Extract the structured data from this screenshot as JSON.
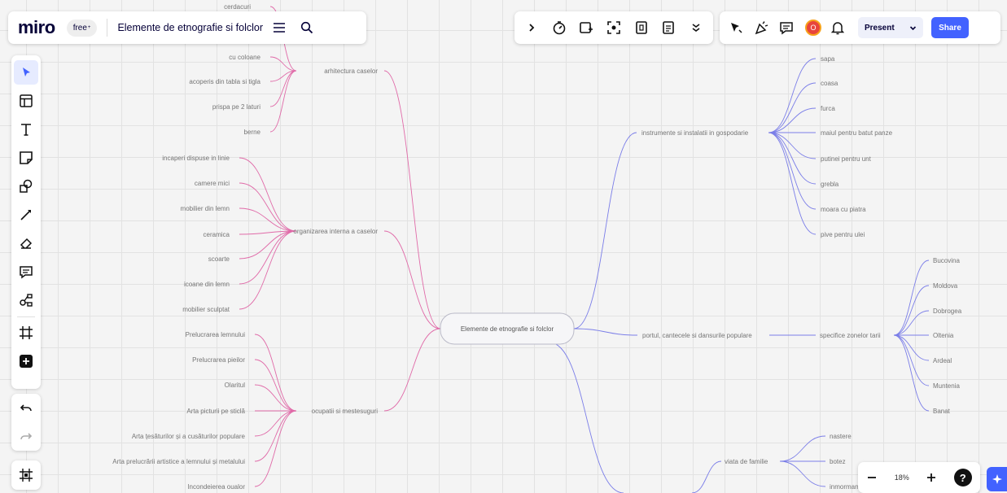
{
  "app": {
    "logo": "miro",
    "plan": "free",
    "plan_mark": "+",
    "board_title": "Elemente de etnografie si folclor"
  },
  "toolbar": {
    "present": "Present",
    "share": "Share",
    "avatar_initial": "O"
  },
  "zoom": {
    "level": "18%"
  },
  "icons": {
    "board": [
      "menu-icon",
      "search-icon"
    ],
    "top": [
      "chevron-right-icon",
      "timer-icon",
      "add-frame-icon",
      "focus-icon",
      "voting-icon",
      "notes-icon",
      "more-icon"
    ],
    "collab": [
      "reactions-icon",
      "celebrate-icon",
      "comments-icon"
    ],
    "left": [
      "select-icon",
      "templates-icon",
      "text-icon",
      "sticky-note-icon",
      "shapes-icon",
      "pen-icon",
      "eraser-icon",
      "comment-icon",
      "mindmap-icon",
      "frame-icon",
      "add-app-icon"
    ]
  },
  "colors": {
    "accent": "#4262ff",
    "branch_left": "#e06aa8",
    "branch_right": "#7b7ee8"
  },
  "mindmap": {
    "root": "Elemente de etnografie si folclor",
    "top_cut": "cerdacuri",
    "branches": {
      "arhitectura": {
        "label": "arhitectura caselor",
        "leaves": [
          "cu coloane",
          "acoperis din tabla si tigla",
          "prispa pe 2 laturi",
          "berne"
        ]
      },
      "organizarea": {
        "label": "organizarea interna a caselor",
        "leaves": [
          "incaperi dispuse in linie",
          "camere mici",
          "mobilier din lemn",
          "ceramica",
          "scoarte",
          "icoane din lemn",
          "mobilier sculptat"
        ]
      },
      "ocupatii": {
        "label": "ocupatii si mestesuguri",
        "leaves": [
          "Prelucrarea lemnului",
          "Prelucrarea pieilor",
          "Olaritul",
          "Arta picturii pe sticlă",
          "Arta țesăturilor și a cusăturilor populare",
          "Arta prelucrării artistice a lemnului și metalului",
          "Incondeierea oualor"
        ]
      },
      "instrumente": {
        "label": "instrumente si instalatii in gospodarie",
        "leaves": [
          "sapa",
          "coasa",
          "furca",
          "maiul pentru batut panze",
          "putinei pentru unt",
          "grebla",
          "moara cu piatra",
          "pive pentru ulei"
        ]
      },
      "portul": {
        "label": "portul, cantecele si dansurile populare",
        "sub": "specifice zonelor tarii",
        "leaves": [
          "Bucovina",
          "Moldova",
          "Dobrogea",
          "Oltenia",
          "Ardeal",
          "Muntenia",
          "Banat"
        ]
      },
      "viata": {
        "label": "viata de familie",
        "leaves": [
          "nastere",
          "botez",
          "inmormantare"
        ]
      }
    }
  }
}
